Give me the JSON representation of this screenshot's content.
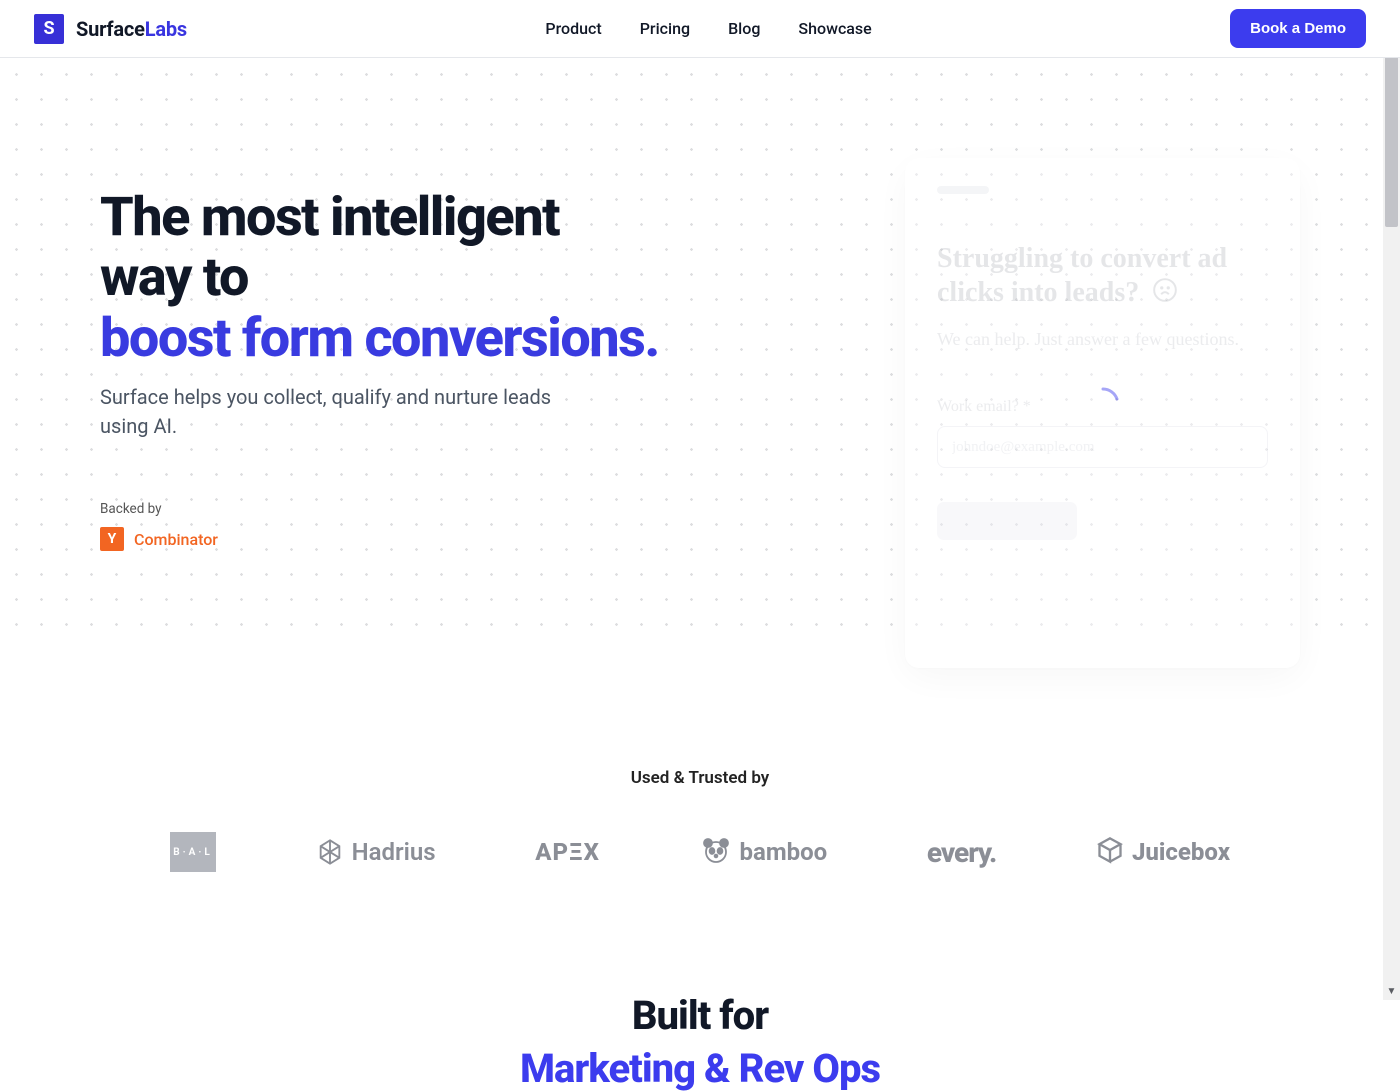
{
  "brand": {
    "first": "Surface",
    "second": "Labs",
    "logo_letter": "S"
  },
  "nav": {
    "items": [
      "Product",
      "Pricing",
      "Blog",
      "Showcase"
    ],
    "cta": "Book a Demo"
  },
  "hero": {
    "headline_plain": "The most intelligent way to",
    "headline_accent": "boost form conversions.",
    "sub": "Surface helps you collect, qualify and nurture leads using AI.",
    "backed_label": "Backed by",
    "yc_letter": "Y",
    "yc_text": "Combinator"
  },
  "card": {
    "title": "Struggling to convert ad clicks into leads?",
    "sub": "We can help. Just answer a few questions.",
    "field_label": "Work email? *",
    "placeholder": "johndoe@example.com"
  },
  "trusted": {
    "title": "Used & Trusted by",
    "logos": {
      "bal": "B·A·L",
      "hadrius": "Hadrius",
      "apex": "APΞX",
      "bamboo": "bamboo",
      "every": "every.",
      "juicebox": "Juicebox"
    }
  },
  "built": {
    "line1": "Built for",
    "line2": "Marketing & Rev Ops"
  }
}
